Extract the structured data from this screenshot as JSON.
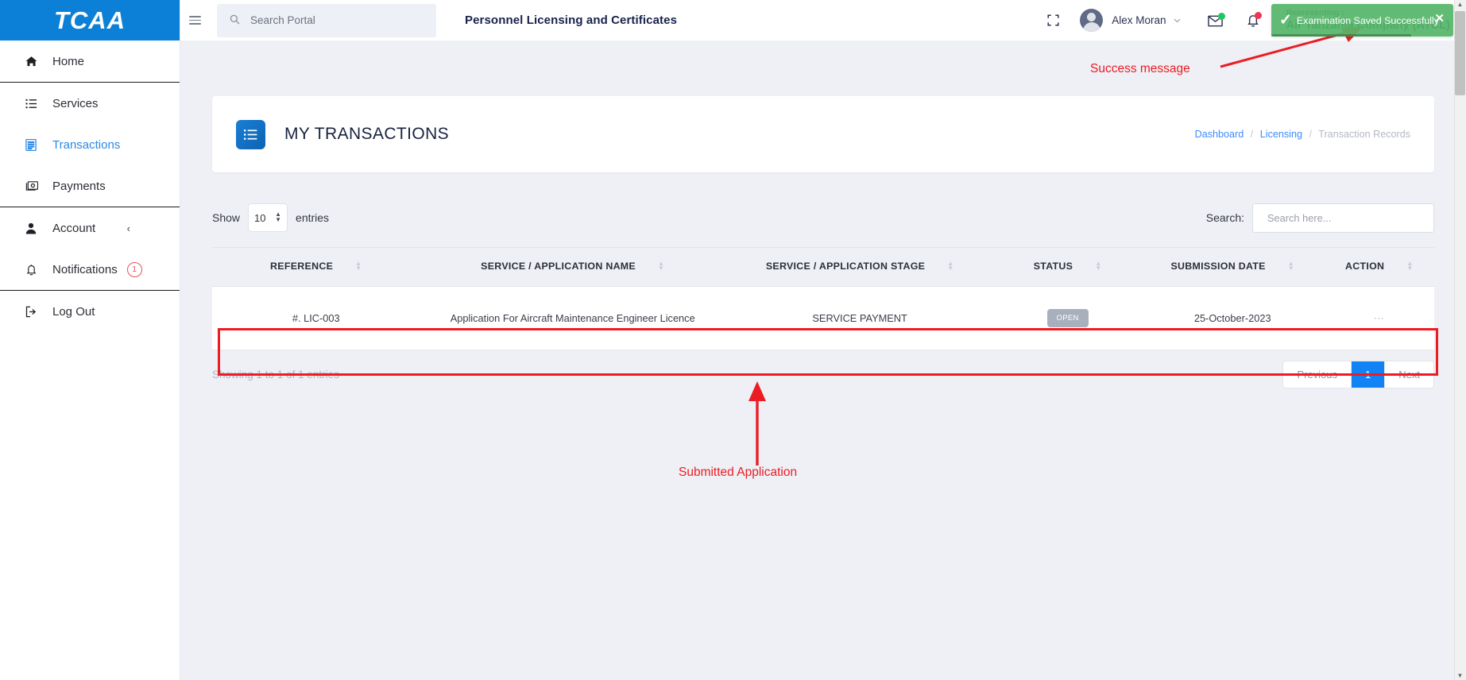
{
  "brand": {
    "name": "TCAA",
    "logo_icon": "paper-plane-icon"
  },
  "topbar": {
    "menu_icon": "hamburger-menu-icon",
    "search": {
      "icon": "search-icon",
      "placeholder": "Search Portal",
      "value": ""
    },
    "page_title": "Personnel Licensing and Certificates",
    "expand_icon": "fullscreen-expand-icon",
    "avatar_icon": "user-avatar-icon",
    "username": "Alex Moran",
    "user_caret_icon": "chevron-down-icon",
    "mail_icon": "envelope-icon",
    "bell_icon": "bell-icon",
    "representing_label": "Representing :",
    "representing_value": "Air Tanzania Company (ATCL)"
  },
  "toast": {
    "check_icon": "check-icon",
    "message": "Examination Saved Successfully",
    "close_icon": "close-icon",
    "color": "#56b66a"
  },
  "sidebar": {
    "groups": [
      {
        "items": [
          {
            "label": "Home",
            "icon": "home-icon",
            "active": false
          }
        ]
      },
      {
        "items": [
          {
            "label": "Services",
            "icon": "list-icon",
            "active": false
          },
          {
            "label": "Transactions",
            "icon": "document-icon",
            "active": true
          },
          {
            "label": "Payments",
            "icon": "money-card-icon",
            "active": false
          }
        ]
      },
      {
        "items": [
          {
            "label": "Account",
            "icon": "person-icon",
            "active": false,
            "chevron": "‹"
          },
          {
            "label": "Notifications",
            "icon": "bell-icon",
            "active": false,
            "badge": "1"
          }
        ]
      },
      {
        "items": [
          {
            "label": "Log Out",
            "icon": "logout-icon",
            "active": false
          }
        ]
      }
    ]
  },
  "card": {
    "icon": "list-checklist-icon",
    "title": "MY TRANSACTIONS",
    "breadcrumb": {
      "items": [
        "Dashboard",
        "Licensing",
        "Transaction Records"
      ],
      "separator": "/"
    }
  },
  "table_controls": {
    "show_label": "Show",
    "entries_value": "10",
    "entries_label": "entries",
    "search_label": "Search:",
    "search_placeholder": "Search here...",
    "search_value": ""
  },
  "table": {
    "columns": [
      "REFERENCE",
      "SERVICE / APPLICATION NAME",
      "SERVICE / APPLICATION STAGE",
      "STATUS",
      "SUBMISSION DATE",
      "ACTION"
    ],
    "rows": [
      {
        "reference": "#. LIC-003",
        "service_name": "Application For Aircraft Maintenance Engineer Licence",
        "stage": "SERVICE PAYMENT",
        "status": "OPEN",
        "submission_date": "25-October-2023",
        "action": "⋯"
      }
    ]
  },
  "footer": {
    "entries_info": "Showing 1 to 1 of 1 entries",
    "pagination": {
      "previous": "Previous",
      "pages": [
        "1"
      ],
      "current": "1",
      "next": "Next"
    }
  },
  "annotations": [
    {
      "text": "Success message",
      "color": "#ec1c24"
    },
    {
      "text": "Submitted Application",
      "color": "#ec1c24"
    }
  ]
}
